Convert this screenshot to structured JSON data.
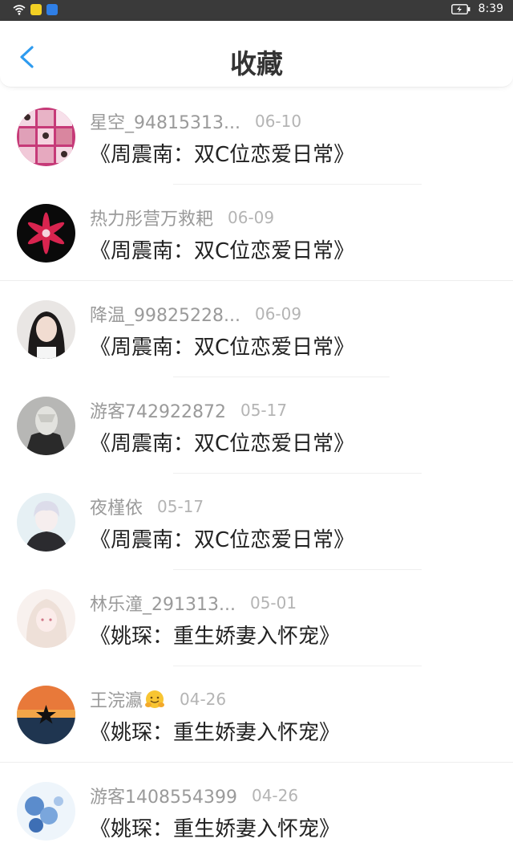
{
  "status": {
    "time": "8:39",
    "icons": [
      "wifi-icon",
      "app-badge-yellow-icon",
      "app-badge-blue-icon",
      "battery-charging-icon"
    ]
  },
  "header": {
    "title": "收藏",
    "back_icon": "chevron-left-icon",
    "accent": "#2e9bef"
  },
  "favorites": [
    {
      "user": "星空_94815313...",
      "date": "06-10",
      "book": "《周震南：双C位恋爱日常》",
      "avatar": "avatar-collage"
    },
    {
      "user": "热力彤营万救耙",
      "date": "06-09",
      "book": "《周震南：双C位恋爱日常》",
      "avatar": "avatar-lily-flower"
    },
    {
      "user": "降温_99825228...",
      "date": "06-09",
      "book": "《周震南：双C位恋爱日常》",
      "avatar": "avatar-girl-photo"
    },
    {
      "user": "游客742922872",
      "date": "05-17",
      "book": "《周震南：双C位恋爱日常》",
      "avatar": "avatar-masked-figure"
    },
    {
      "user": "夜槿依",
      "date": "05-17",
      "book": "《周震南：双C位恋爱日常》",
      "avatar": "avatar-anime-boy"
    },
    {
      "user": "林乐潼_291313...",
      "date": "05-01",
      "book": "《姚琛：重生娇妻入怀宠》",
      "avatar": "avatar-anime-girl"
    },
    {
      "user": "王浣瀛",
      "date": "04-26",
      "book": "《姚琛：重生娇妻入怀宠》",
      "avatar": "avatar-sunset-star",
      "emoji": "hugging-face-emoji"
    },
    {
      "user": "游客1408554399",
      "date": "04-26",
      "book": "《姚琛：重生娇妻入怀宠》",
      "avatar": "avatar-blue-flowers"
    }
  ]
}
